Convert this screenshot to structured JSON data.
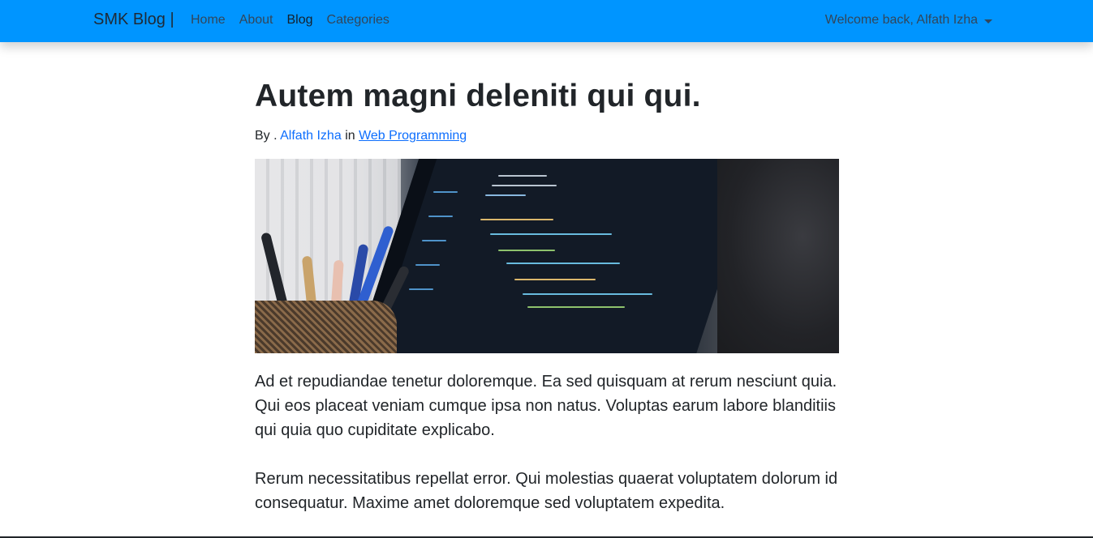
{
  "navbar": {
    "brand": "SMK Blog |",
    "links": [
      {
        "label": "Home",
        "active": false
      },
      {
        "label": "About",
        "active": false
      },
      {
        "label": "Blog",
        "active": true
      },
      {
        "label": "Categories",
        "active": false
      }
    ],
    "user_menu": "Welcome back, Alfath Izha",
    "color": "#0095ff"
  },
  "post": {
    "title": "Autem magni deleniti qui qui.",
    "by_prefix": "By .",
    "author": "Alfath Izha",
    "in_word": "in",
    "category": "Web Programming",
    "image_icon": "code-on-laptop-photo",
    "paragraphs": [
      "Ad et repudiandae tenetur doloremque. Ea sed quisquam at rerum nesciunt quia. Qui eos placeat veniam cumque ipsa non natus. Voluptas earum labore blanditiis qui quia quo cupiditate explicabo.",
      "Rerum necessitatibus repellat error. Qui molestias quaerat voluptatem dolorum id consequatur. Maxime amet doloremque sed voluptatem expedita."
    ]
  }
}
